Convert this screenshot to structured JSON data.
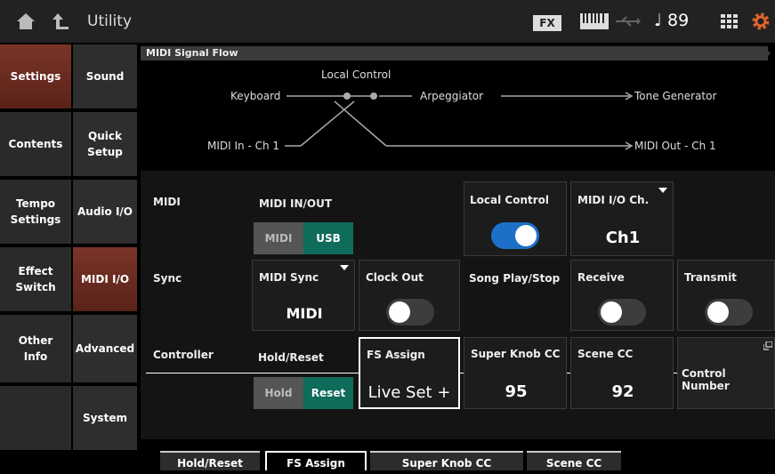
{
  "header": {
    "title": "Utility",
    "fx_badge": "FX",
    "tempo": "♩ 89",
    "icons": [
      "home-icon",
      "up-arrow-icon",
      "keyboard-icon",
      "usb-icon",
      "grid-icon",
      "gear-icon"
    ],
    "gear_color": "#e0632a"
  },
  "tabs_left": [
    "Settings",
    "Contents",
    "Tempo\nSettings",
    "Effect\nSwitch",
    "Other\nInfo"
  ],
  "tabs_right": [
    "Sound",
    "Quick\nSetup",
    "Audio I/O",
    "MIDI I/O",
    "Advanced",
    "System"
  ],
  "selected_left": "Settings",
  "selected_right": "MIDI I/O",
  "flow": {
    "title": "MIDI Signal Flow",
    "local_control": "Local Control",
    "keyboard": "Keyboard",
    "arpeggiator": "Arpeggiator",
    "tone_generator": "Tone Generator",
    "midi_in": "MIDI In - Ch 1",
    "midi_out": "MIDI Out - Ch 1"
  },
  "params": {
    "midi_label": "MIDI",
    "midi_inout_label": "MIDI IN/OUT",
    "midi_btn": "MIDI",
    "usb_btn": "USB",
    "local_control_label": "Local Control",
    "local_control_on": true,
    "midi_io_ch_label": "MIDI I/O Ch.",
    "midi_io_ch_value": "Ch1",
    "sync_label": "Sync",
    "midi_sync_label": "MIDI Sync",
    "midi_sync_value": "MIDI",
    "clock_out_label": "Clock Out",
    "clock_out_on": false,
    "song_play_stop_label": "Song Play/Stop",
    "receive_label": "Receive",
    "receive_on": false,
    "transmit_label": "Transmit",
    "transmit_on": false,
    "controller_label": "Controller",
    "hold_reset_label": "Hold/Reset",
    "hold_btn": "Hold",
    "reset_btn": "Reset",
    "fs_assign_label": "FS Assign",
    "fs_assign_value": "Live Set +",
    "super_knob_cc_label": "Super Knob CC",
    "super_knob_cc_value": "95",
    "scene_cc_label": "Scene CC",
    "scene_cc_value": "92",
    "control_number_label": "Control Number"
  },
  "bottom_tabs": [
    "Hold/Reset",
    "FS Assign",
    "Super Knob CC",
    "Scene CC"
  ],
  "colors": {
    "selected_tab": "#7a3428",
    "usb_active": "#0f6b5a",
    "toggle_on": "#1c70c8"
  }
}
